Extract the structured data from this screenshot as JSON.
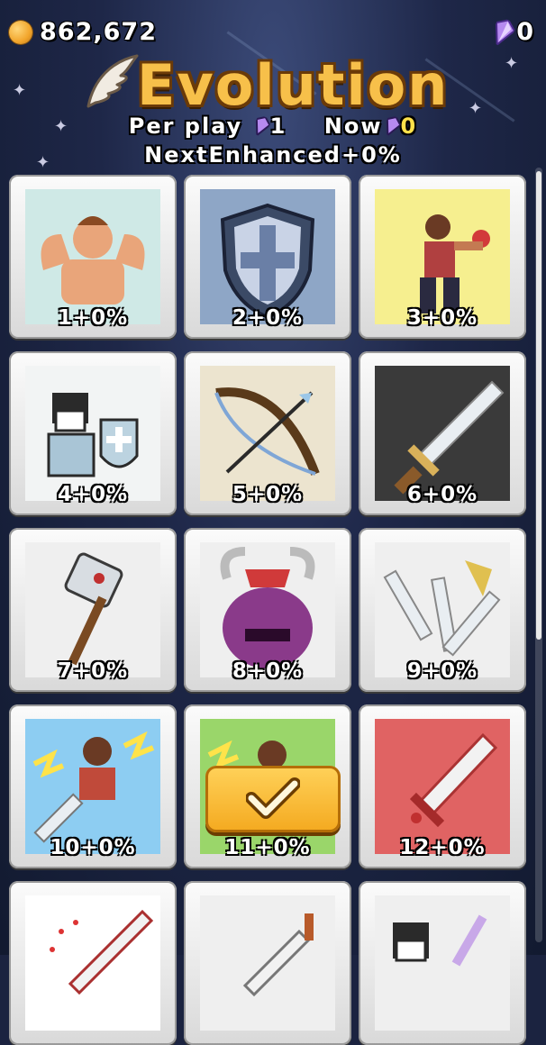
{
  "header": {
    "coins": "862,672",
    "gems": "0",
    "title": "Evolution",
    "per_play_label": "Per play",
    "per_play_value": "1",
    "now_label": "Now",
    "now_value": "0",
    "next_enhanced": "NextEnhanced+0%"
  },
  "cards": [
    {
      "label": "1+0%",
      "icon": "strongman-icon",
      "bg": "#cfe9e6"
    },
    {
      "label": "2+0%",
      "icon": "shield-icon",
      "bg": "#8ea6c6"
    },
    {
      "label": "3+0%",
      "icon": "boxer-icon",
      "bg": "#f6ef8f"
    },
    {
      "label": "4+0%",
      "icon": "knight-icon",
      "bg": "#f2f4f4"
    },
    {
      "label": "5+0%",
      "icon": "bow-icon",
      "bg": "#ece4cf"
    },
    {
      "label": "6+0%",
      "icon": "sword-icon",
      "bg": "#3a3a3a"
    },
    {
      "label": "7+0%",
      "icon": "mace-icon",
      "bg": "#efefef"
    },
    {
      "label": "8+0%",
      "icon": "demon-icon",
      "bg": "#efefef"
    },
    {
      "label": "9+0%",
      "icon": "triple-sword-icon",
      "bg": "#efefef"
    },
    {
      "label": "10+0%",
      "icon": "lightning-warrior-icon",
      "bg": "#8dcdf2"
    },
    {
      "label": "11+0%",
      "icon": "lightning-warrior-green-icon",
      "bg": "#9ad66a"
    },
    {
      "label": "12+0%",
      "icon": "red-sword-icon",
      "bg": "#e06363"
    },
    {
      "label": "",
      "icon": "blood-sword-icon",
      "bg": "#ffffff"
    },
    {
      "label": "",
      "icon": "dagger-icon",
      "bg": "#efefef"
    },
    {
      "label": "",
      "icon": "dark-hero-icon",
      "bg": "#efefef"
    }
  ],
  "confirm_button": {
    "icon": "checkmark-icon"
  },
  "colors": {
    "title": "#f7c04a",
    "gem": "#9b6ae0",
    "coin": "#f2a52b"
  }
}
